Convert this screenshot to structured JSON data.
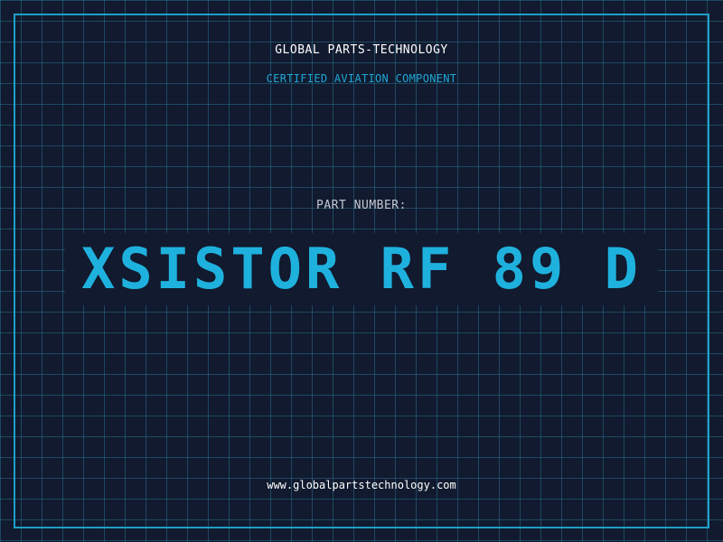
{
  "header": {
    "company": "GLOBAL PARTS-TECHNOLOGY",
    "certification": "CERTIFIED AVIATION COMPONENT"
  },
  "part": {
    "label": "PART NUMBER:",
    "number": "XSISTOR RF 89 D"
  },
  "footer": {
    "website": "www.globalpartstechnology.com"
  },
  "colors": {
    "background": "#111a2e",
    "accent": "#1fb1de",
    "grid": "#286e8c",
    "text": "#ffffff"
  }
}
